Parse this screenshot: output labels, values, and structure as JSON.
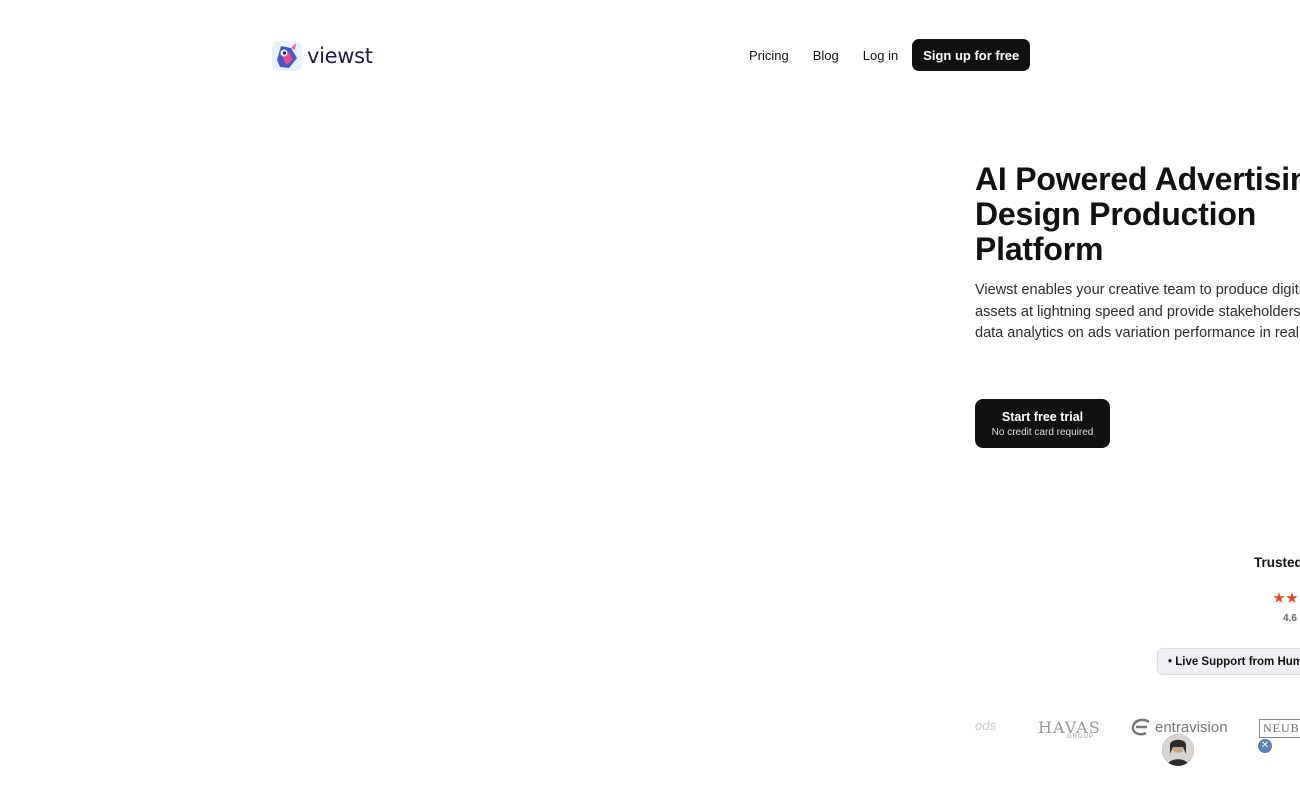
{
  "brand": {
    "name": "viewst"
  },
  "nav": {
    "links": [
      "Pricing",
      "Blog",
      "Log in"
    ],
    "cta": "Sign up for free"
  },
  "hero": {
    "title": "AI Powered Advertising Design Production Platform",
    "description": "Viewst enables your creative team to produce digital assets at lightning speed and provide stakeholders with data analytics on ads variation performance in real time.",
    "cta_label": "Start free trial",
    "cta_sublabel": "No credit card required"
  },
  "trust": {
    "heading": "Trusted",
    "rating": "4.6",
    "stars_visible": 2,
    "support_pill": "• Live Support from Humans"
  },
  "logos": {
    "partial": "ods",
    "havas": "HAVAS",
    "havas_sub": "GROUP",
    "entravision": "entravision",
    "neuberger": "NEUBE"
  },
  "chat": {
    "close_glyph": "✕"
  },
  "colors": {
    "accent": "#111111",
    "star": "#e8452b",
    "close": "#5d7fb4"
  }
}
